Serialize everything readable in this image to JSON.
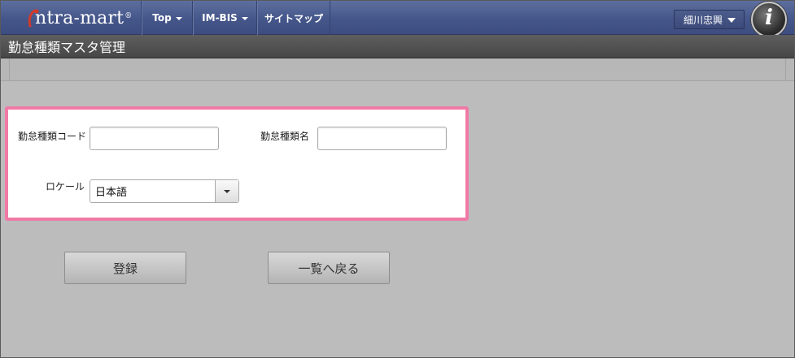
{
  "header": {
    "logo_text": "ntra-mart",
    "logo_mark": "®",
    "nav": [
      {
        "label": "Top"
      },
      {
        "label": "IM-BIS"
      },
      {
        "label": "サイトマップ"
      }
    ],
    "user_name": "細川忠興",
    "info_badge": "i"
  },
  "page": {
    "title": "勤怠種類マスタ管理"
  },
  "form": {
    "code_label": "勤怠種類コード",
    "code_value": "",
    "name_label": "勤怠種類名",
    "name_value": "",
    "locale_label": "ロケール",
    "locale_value": "日本語"
  },
  "actions": {
    "register_label": "登録",
    "back_label": "一覧へ戻る"
  },
  "colors": {
    "nav_bg": "#45568a",
    "title_bg": "#4f4f4f",
    "highlight_border": "#f07aa6",
    "page_bg": "#bcbcbc"
  },
  "icons": {
    "logo": "intra-mart-logo-icon",
    "user_dropdown": "chevron-down-icon",
    "info": "info-icon",
    "select_arrow": "chevron-down-icon"
  }
}
